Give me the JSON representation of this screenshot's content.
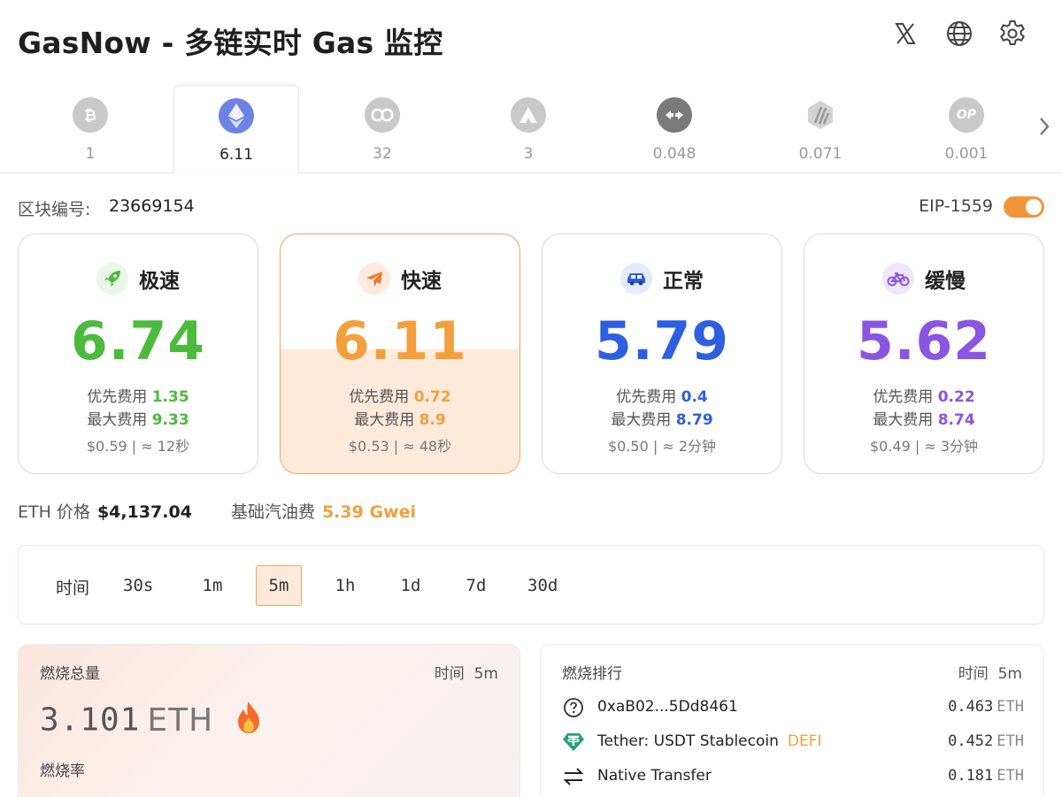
{
  "header": {
    "title": "GasNow - 多链实时 Gas 监控"
  },
  "chains": [
    {
      "icon": "bitcoin-icon",
      "value": "1",
      "active": false
    },
    {
      "icon": "ethereum-icon",
      "value": "6.11",
      "active": true
    },
    {
      "icon": "polygon-icon",
      "value": "32",
      "active": false
    },
    {
      "icon": "avalanche-icon",
      "value": "3",
      "active": false
    },
    {
      "icon": "bridge-icon",
      "value": "0.048",
      "active": false
    },
    {
      "icon": "arbitrum-icon",
      "value": "0.071",
      "active": false
    },
    {
      "icon": "optimism-icon",
      "value": "0.001",
      "active": false,
      "badge_text": "OP"
    }
  ],
  "block": {
    "label": "区块编号:",
    "number": "23669154",
    "eip_label": "EIP-1559",
    "eip_enabled": true
  },
  "speeds": [
    {
      "icon": "rocket-icon",
      "name": "极速",
      "gas": "6.74",
      "priority_label": "优先费用",
      "priority": "1.35",
      "max_label": "最大费用",
      "max": "9.33",
      "footer": "$0.59 | ≈ 12秒",
      "color": "#4cba3c",
      "badge_bg": "#e8f7e6",
      "selected": false,
      "fill_level": 0
    },
    {
      "icon": "airplane-icon",
      "name": "快速",
      "gas": "6.11",
      "priority_label": "优先费用",
      "priority": "0.72",
      "max_label": "最大费用",
      "max": "8.9",
      "footer": "$0.53 | ≈ 48秒",
      "color": "#f2a03d",
      "badge_bg": "#fdebe0",
      "selected": true,
      "fill_level": 0.52
    },
    {
      "icon": "car-icon",
      "name": "正常",
      "gas": "5.79",
      "priority_label": "优先费用",
      "priority": "0.4",
      "max_label": "最大费用",
      "max": "8.79",
      "footer": "$0.50 | ≈ 2分钟",
      "color": "#2d5fe0",
      "badge_bg": "#e4ecfc",
      "selected": false,
      "fill_level": 0
    },
    {
      "icon": "bicycle-icon",
      "name": "缓慢",
      "gas": "5.62",
      "priority_label": "优先费用",
      "priority": "0.22",
      "max_label": "最大费用",
      "max": "8.74",
      "footer": "$0.49 | ≈ 3分钟",
      "color": "#8a55e0",
      "badge_bg": "#efe6fb",
      "selected": false,
      "fill_level": 0
    }
  ],
  "market": {
    "eth_label": "ETH 价格",
    "eth_price": "$4,137.04",
    "base_fee_label": "基础汽油费",
    "base_fee": "5.39 Gwei"
  },
  "range": {
    "label": "时间",
    "options": [
      "30s",
      "1m",
      "5m",
      "1h",
      "1d",
      "7d",
      "30d"
    ],
    "selected": "5m"
  },
  "burn": {
    "title": "燃烧总量",
    "time_label": "时间",
    "time_value": "5m",
    "amount": "3.101",
    "unit": "ETH",
    "rate_label": "燃烧率"
  },
  "ranking": {
    "title": "燃烧排行",
    "time_label": "时间",
    "time_value": "5m",
    "rows": [
      {
        "icon": "question-circle-icon",
        "name": "0xaB02...5Dd8461",
        "tag": "",
        "value": "0.463",
        "unit": "ETH"
      },
      {
        "icon": "tether-icon",
        "name": "Tether: USDT Stablecoin",
        "tag": "DEFI",
        "value": "0.452",
        "unit": "ETH"
      },
      {
        "icon": "transfer-arrows-icon",
        "name": "Native Transfer",
        "tag": "",
        "value": "0.181",
        "unit": "ETH"
      }
    ]
  },
  "colors": {
    "accent": "#f2953b",
    "fast": "#f2a03d",
    "rapid": "#4cba3c",
    "standard": "#2d5fe0",
    "slow": "#8a55e0"
  }
}
